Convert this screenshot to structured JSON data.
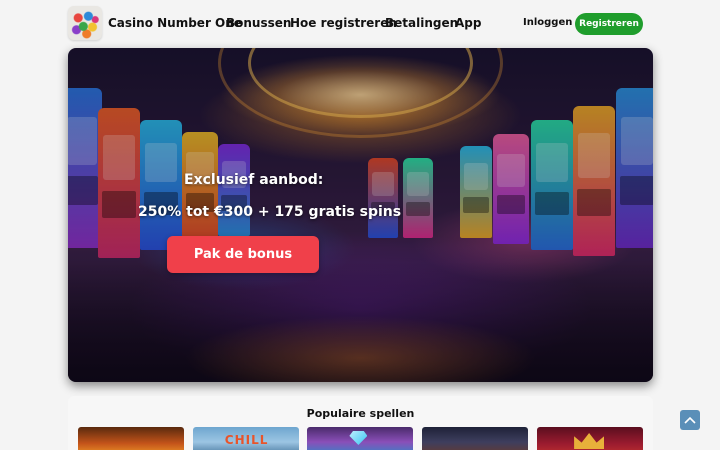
{
  "header": {
    "brand": "Casino Number One",
    "nav": [
      "Bonussen",
      "Hoe registreren",
      "Betalingen",
      "App"
    ],
    "login_label": "Inloggen",
    "register_label": "Registreren",
    "register_color": "#1f9d2c"
  },
  "hero": {
    "title": "Exclusief aanbod:",
    "subtitle": "250% tot €300 + 175 gratis spins",
    "cta_label": "Pak de bonus",
    "cta_color": "#f0404a"
  },
  "games": {
    "title": "Populaire spellen",
    "cards": [
      {
        "icon": "game-thumbnail"
      },
      {
        "icon": "game-thumbnail",
        "tag": "CHILL"
      },
      {
        "icon": "diamond-icon"
      },
      {
        "icon": "game-thumbnail"
      },
      {
        "icon": "crown-icon"
      }
    ]
  },
  "scroll_top": {
    "icon": "chevron-up-icon"
  }
}
